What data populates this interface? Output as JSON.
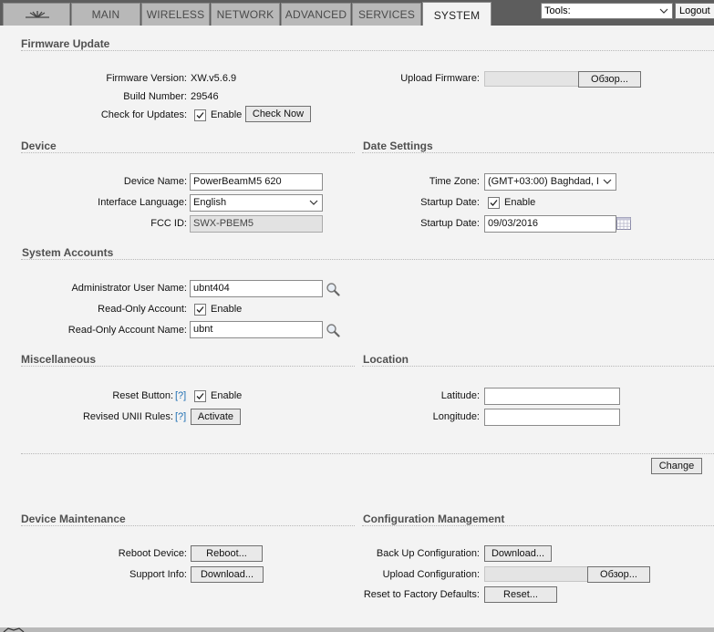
{
  "tabs": [
    {
      "label": "MAIN"
    },
    {
      "label": "WIRELESS"
    },
    {
      "label": "NETWORK"
    },
    {
      "label": "ADVANCED"
    },
    {
      "label": "SERVICES"
    },
    {
      "label": "SYSTEM"
    }
  ],
  "tools": {
    "value": "Tools:"
  },
  "logout": {
    "label": "Logout"
  },
  "firmware": {
    "title": "Firmware Update",
    "version_label": "Firmware Version:",
    "version": "XW.v5.6.9",
    "build_label": "Build Number:",
    "build": "29546",
    "check_label": "Check for Updates:",
    "check_enable": "Enable",
    "check_now": "Check Now",
    "upload_label": "Upload Firmware:",
    "browse": "Обзор..."
  },
  "device": {
    "title": "Device",
    "name_label": "Device Name:",
    "name": "PowerBeamM5 620",
    "lang_label": "Interface Language:",
    "lang": "English",
    "fcc_label": "FCC ID:",
    "fcc": "SWX-PBEM5"
  },
  "date": {
    "title": "Date Settings",
    "tz_label": "Time Zone:",
    "tz": "(GMT+03:00) Baghdad, I",
    "startup_label": "Startup Date:",
    "startup_enable": "Enable",
    "startup_date_label": "Startup Date:",
    "startup_date": "09/03/2016"
  },
  "accounts": {
    "title": "System Accounts",
    "admin_label": "Administrator User Name:",
    "admin": "ubnt404",
    "ro_label": "Read-Only Account:",
    "ro_enable": "Enable",
    "ro_name_label": "Read-Only Account Name:",
    "ro_name": "ubnt"
  },
  "misc": {
    "title": "Miscellaneous",
    "reset_label": "Reset Button:",
    "help": "[?]",
    "reset_enable": "Enable",
    "unii_label": "Revised UNII Rules:",
    "activate": "Activate"
  },
  "location": {
    "title": "Location",
    "lat_label": "Latitude:",
    "lat": "",
    "lon_label": "Longitude:",
    "lon": ""
  },
  "change": "Change",
  "maintenance": {
    "title": "Device Maintenance",
    "reboot_label": "Reboot Device:",
    "reboot": "Reboot...",
    "support_label": "Support Info:",
    "support": "Download..."
  },
  "config": {
    "title": "Configuration Management",
    "backup_label": "Back Up Configuration:",
    "backup": "Download...",
    "upload_label": "Upload Configuration:",
    "browse": "Обзор...",
    "reset_label": "Reset to Factory Defaults:",
    "reset": "Reset..."
  }
}
